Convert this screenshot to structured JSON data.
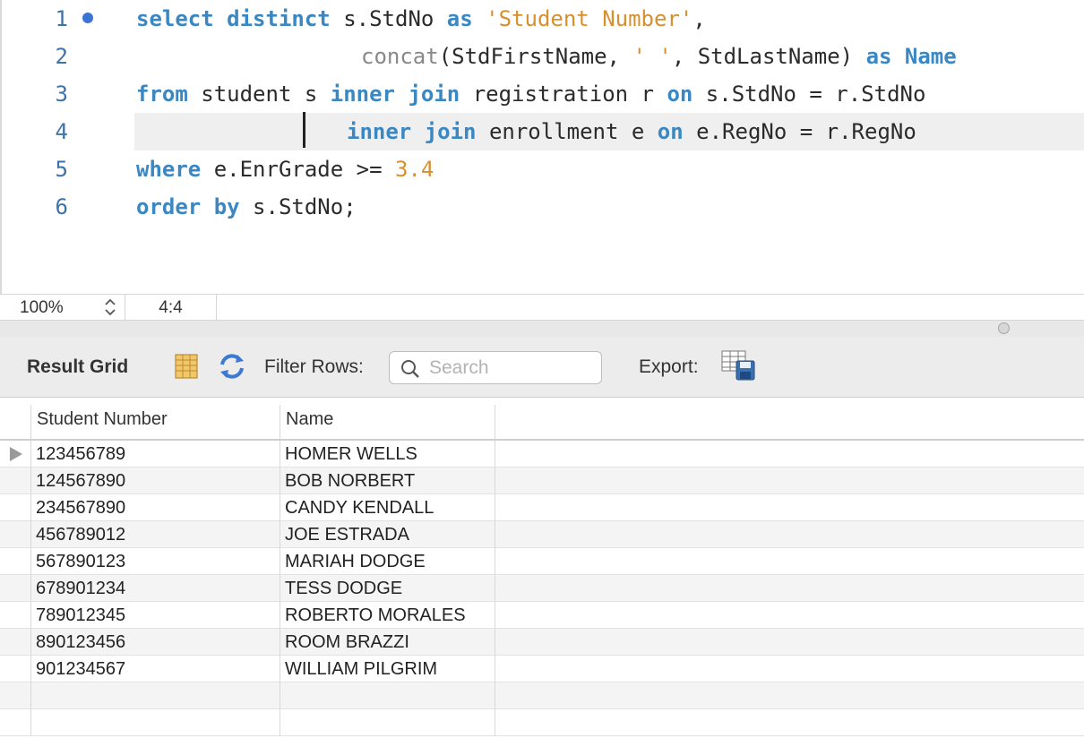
{
  "editor": {
    "lines": [
      {
        "number": "1",
        "tokens": [
          {
            "t": "select distinct",
            "c": "kw"
          },
          {
            "t": " s.StdNo ",
            "c": ""
          },
          {
            "t": "as",
            "c": "kw"
          },
          {
            "t": " ",
            "c": ""
          },
          {
            "t": "'Student Number'",
            "c": "str"
          },
          {
            "t": ",",
            "c": ""
          }
        ]
      },
      {
        "number": "2",
        "tokens": [
          {
            "t": "concat",
            "c": "fn"
          },
          {
            "t": "(StdFirstName, ",
            "c": ""
          },
          {
            "t": "' '",
            "c": "str"
          },
          {
            "t": ", StdLastName) ",
            "c": ""
          },
          {
            "t": "as Name",
            "c": "kw"
          }
        ]
      },
      {
        "number": "3",
        "tokens": [
          {
            "t": "from",
            "c": "kw"
          },
          {
            "t": " student s ",
            "c": ""
          },
          {
            "t": "inner join",
            "c": "kw"
          },
          {
            "t": " registration r ",
            "c": ""
          },
          {
            "t": "on",
            "c": "kw"
          },
          {
            "t": " s.StdNo = r.StdNo",
            "c": ""
          }
        ]
      },
      {
        "number": "4",
        "tokens": [
          {
            "t": "inner join",
            "c": "kw"
          },
          {
            "t": " enrollment e ",
            "c": ""
          },
          {
            "t": "on",
            "c": "kw"
          },
          {
            "t": " e.RegNo = r.RegNo",
            "c": ""
          }
        ]
      },
      {
        "number": "5",
        "tokens": [
          {
            "t": "where",
            "c": "kw"
          },
          {
            "t": " e.EnrGrade >= ",
            "c": ""
          },
          {
            "t": "3.4",
            "c": "num"
          }
        ]
      },
      {
        "number": "6",
        "tokens": [
          {
            "t": "order by",
            "c": "kw"
          },
          {
            "t": " s.StdNo;",
            "c": ""
          }
        ]
      }
    ]
  },
  "status": {
    "zoom": "100%",
    "cursor_position": "4:4"
  },
  "toolbar": {
    "title": "Result Grid",
    "filter_label": "Filter Rows:",
    "search_placeholder": "Search",
    "export_label": "Export:"
  },
  "grid": {
    "columns": [
      "Student Number",
      "Name"
    ],
    "rows": [
      [
        "123456789",
        "HOMER WELLS"
      ],
      [
        "124567890",
        "BOB NORBERT"
      ],
      [
        "234567890",
        "CANDY KENDALL"
      ],
      [
        "456789012",
        "JOE ESTRADA"
      ],
      [
        "567890123",
        "MARIAH DODGE"
      ],
      [
        "678901234",
        "TESS DODGE"
      ],
      [
        "789012345",
        "ROBERTO MORALES"
      ],
      [
        "890123456",
        "ROOM BRAZZI"
      ],
      [
        "901234567",
        "WILLIAM PILGRIM"
      ]
    ]
  },
  "colors": {
    "keyword": "#3b87c2",
    "string": "#d8902e",
    "line_number": "#3f72a6",
    "breakpoint": "#3b73d6"
  },
  "icons": [
    "breakpoint-dot",
    "zoom-stepper-icon",
    "grid-toggle-icon",
    "refresh-icon",
    "search-icon",
    "export-icon",
    "row-marker-icon"
  ]
}
